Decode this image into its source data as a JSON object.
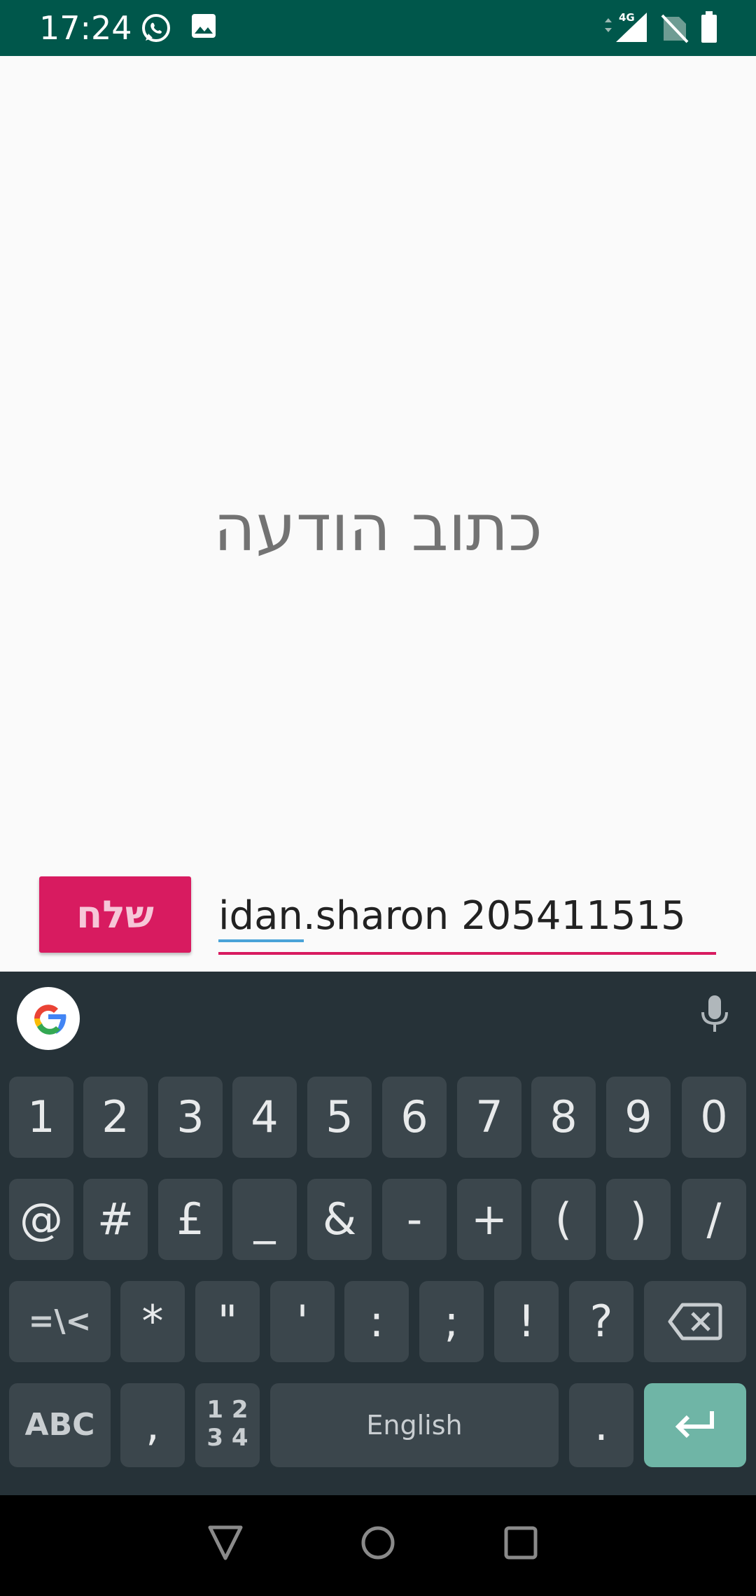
{
  "status_bar": {
    "time": "17:24",
    "network_label": "4G",
    "icons": [
      "whatsapp-icon",
      "gallery-icon",
      "signal-icon",
      "no-sim-icon",
      "battery-icon"
    ]
  },
  "main": {
    "prompt": "כתוב הודעה",
    "send_label": "שלח",
    "message_value": "idan.sharon 205411515"
  },
  "keyboard": {
    "row1": [
      "1",
      "2",
      "3",
      "4",
      "5",
      "6",
      "7",
      "8",
      "9",
      "0"
    ],
    "row2": [
      "@",
      "#",
      "£",
      "_",
      "&",
      "-",
      "+",
      "(",
      ")",
      "/"
    ],
    "row3": [
      "=\\<",
      "*",
      "\"",
      "'",
      ":",
      ";",
      "!",
      "?"
    ],
    "row4": {
      "abc": "ABC",
      "comma": ",",
      "numpad_top": "1 2",
      "numpad_bottom": "3 4",
      "space": "English",
      "period": "."
    }
  },
  "colors": {
    "status_bar": "#00574b",
    "accent": "#d81b60",
    "keyboard_bg": "#263238",
    "key_bg": "#3b464c",
    "enter_key": "#6fb5a6"
  }
}
